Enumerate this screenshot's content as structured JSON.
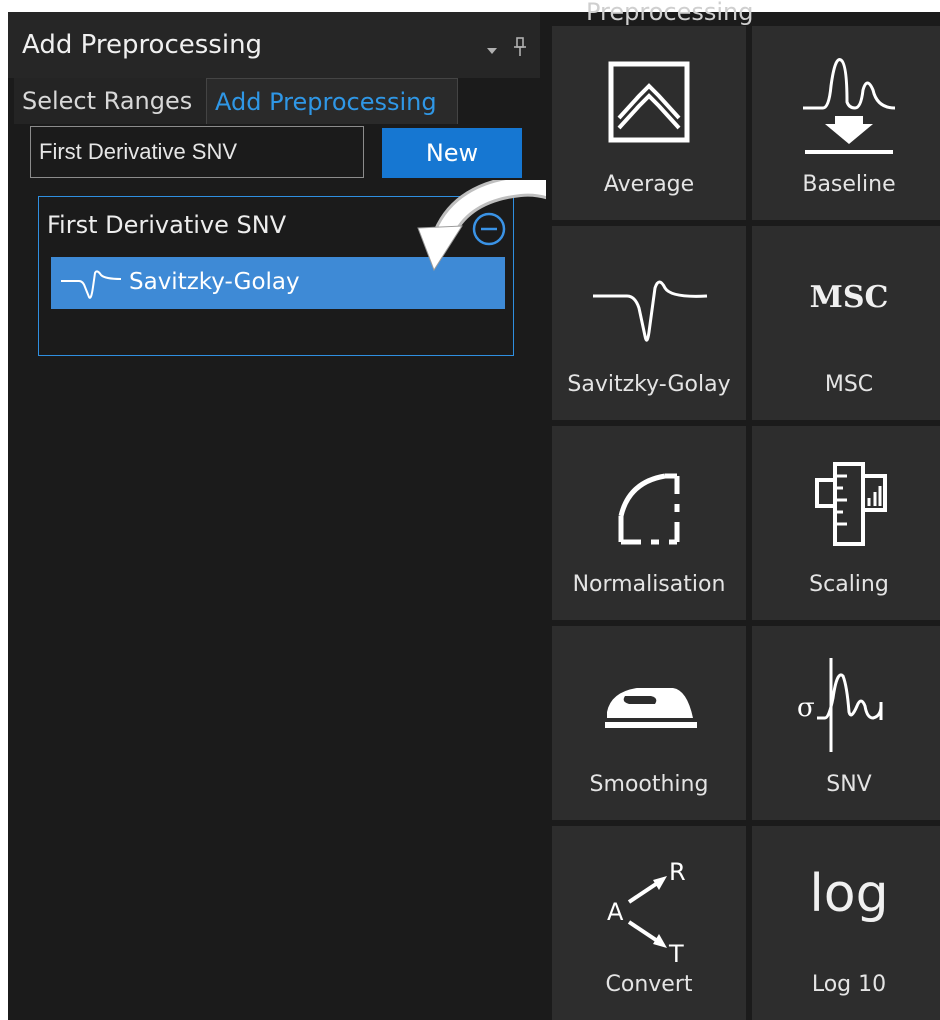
{
  "panel": {
    "title": "Add Preprocessing",
    "tabs": [
      {
        "label": "Select Ranges",
        "active": false
      },
      {
        "label": "Add Preprocessing",
        "active": true
      }
    ]
  },
  "editor": {
    "name_value": "First Derivative SNV",
    "new_button_label": "New",
    "group_title": "First Derivative SNV",
    "steps": [
      {
        "label": "Savitzky-Golay",
        "icon": "derivative-wave-icon",
        "selected": true
      }
    ]
  },
  "library": {
    "header_partial": "Preprocessing",
    "tiles": [
      {
        "label": "Average",
        "icon": "average-icon"
      },
      {
        "label": "Baseline",
        "icon": "baseline-icon"
      },
      {
        "label": "Savitzky-Golay",
        "icon": "derivative-wave-icon"
      },
      {
        "label": "MSC",
        "icon": "msc-icon",
        "glyph": "MSC"
      },
      {
        "label": "Normalisation",
        "icon": "normalisation-icon"
      },
      {
        "label": "Scaling",
        "icon": "scaling-icon"
      },
      {
        "label": "Smoothing",
        "icon": "iron-icon"
      },
      {
        "label": "SNV",
        "icon": "snv-icon",
        "glyph": "σ"
      },
      {
        "label": "Convert",
        "icon": "convert-icon",
        "glyph_a": "A",
        "glyph_r": "R",
        "glyph_t": "T"
      },
      {
        "label": "Log 10",
        "icon": "log-icon",
        "glyph": "log"
      }
    ]
  },
  "colors": {
    "accent": "#1677d2",
    "selected_item": "#3e8ad6",
    "tab_active_text": "#2f97e6",
    "panel_bg": "#1b1b1b",
    "tile_bg": "#2d2d2d"
  }
}
